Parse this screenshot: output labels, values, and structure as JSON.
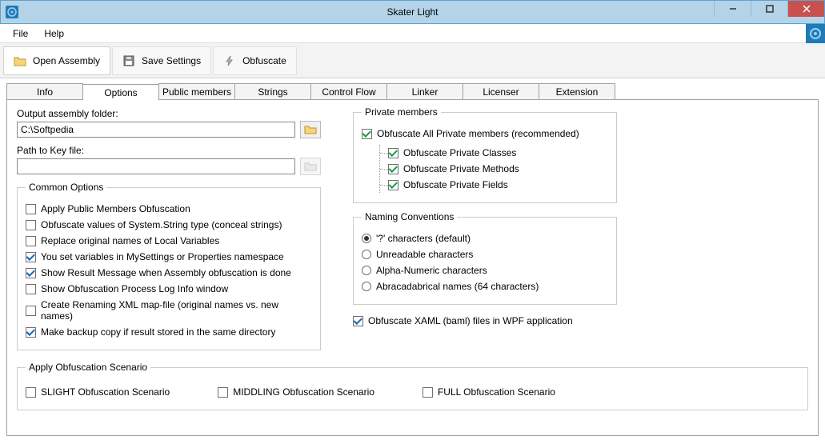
{
  "window": {
    "title": "Skater Light"
  },
  "menu": {
    "file": "File",
    "help": "Help"
  },
  "toolbar": {
    "open_assembly": "Open Assembly",
    "save_settings": "Save Settings",
    "obfuscate": "Obfuscate"
  },
  "tabs": {
    "info": "Info",
    "options": "Options",
    "public_members": "Public members",
    "strings": "Strings",
    "control_flow": "Control Flow",
    "linker": "Linker",
    "licenser": "Licenser",
    "extension": "Extension"
  },
  "options": {
    "output_label": "Output assembly folder:",
    "output_value": "C:\\Softpedia",
    "keyfile_label": "Path to Key file:",
    "keyfile_value": ""
  },
  "common": {
    "legend": "Common Options",
    "apply_public": "Apply Public Members Obfuscation",
    "obf_strings": "Obfuscate values of System.String type (conceal strings)",
    "replace_local": "Replace original names of Local Variables",
    "mysettings": "You set variables in MySettings or Properties namespace",
    "show_result": "Show Result Message when Assembly obfuscation is done",
    "show_log": "Show Obfuscation Process Log Info window",
    "create_xml": "Create Renaming XML map-file (original names vs. new names)",
    "backup": "Make backup copy if result stored in the same directory"
  },
  "private": {
    "legend": "Private members",
    "all": "Obfuscate All Private members (recommended)",
    "classes": "Obfuscate Private Classes",
    "methods": "Obfuscate Private Methods",
    "fields": "Obfuscate Private Fields"
  },
  "naming": {
    "legend": "Naming Conventions",
    "q": "'?' characters (default)",
    "unreadable": "Unreadable characters",
    "alnum": "Alpha-Numeric characters",
    "abra": "Abracadabrical names (64 characters)"
  },
  "xaml": {
    "label": "Obfuscate XAML (baml) files in WPF application"
  },
  "scenario": {
    "legend": "Apply Obfuscation Scenario",
    "slight": "SLIGHT Obfuscation Scenario",
    "middling": "MIDDLING Obfuscation Scenario",
    "full": "FULL Obfuscation Scenario"
  }
}
